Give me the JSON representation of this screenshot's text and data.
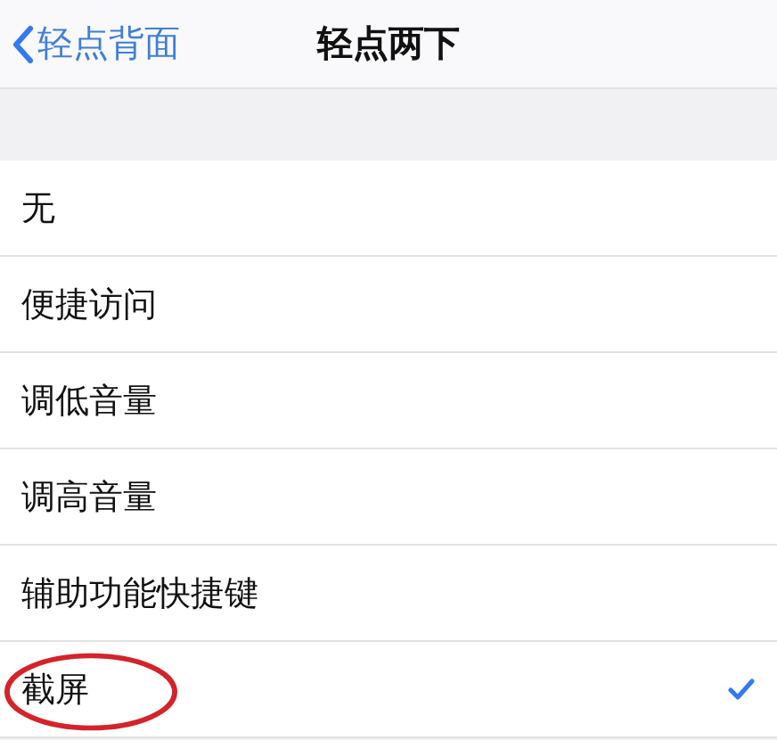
{
  "nav": {
    "back_label": "轻点背面",
    "title": "轻点两下"
  },
  "options": [
    {
      "label": "无",
      "selected": false,
      "circled": false
    },
    {
      "label": "便捷访问",
      "selected": false,
      "circled": false
    },
    {
      "label": "调低音量",
      "selected": false,
      "circled": false
    },
    {
      "label": "调高音量",
      "selected": false,
      "circled": false
    },
    {
      "label": "辅助功能快捷键",
      "selected": false,
      "circled": false
    },
    {
      "label": "截屏",
      "selected": true,
      "circled": true
    }
  ]
}
